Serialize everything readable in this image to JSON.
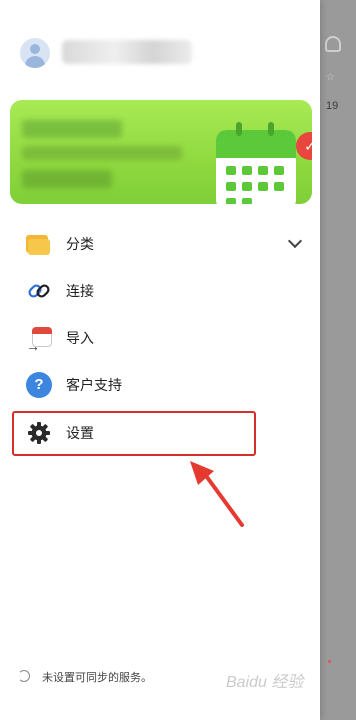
{
  "menu": {
    "items": [
      {
        "label": "分类",
        "icon": "folder-icon",
        "has_chevron": true
      },
      {
        "label": "连接",
        "icon": "link-icon"
      },
      {
        "label": "导入",
        "icon": "calendar-import-icon"
      },
      {
        "label": "客户支持",
        "icon": "help-icon"
      },
      {
        "label": "设置",
        "icon": "gear-icon",
        "highlighted": true
      }
    ]
  },
  "footer": {
    "sync_status": "未设置可同步的服务。"
  },
  "background_app": {
    "date_number": "19"
  },
  "watermark": "Baidu 经验",
  "colors": {
    "accent_green": "#8fd93f",
    "highlight_red": "#d3302a",
    "help_blue": "#3d86e0",
    "folder_yellow": "#f3b735"
  }
}
